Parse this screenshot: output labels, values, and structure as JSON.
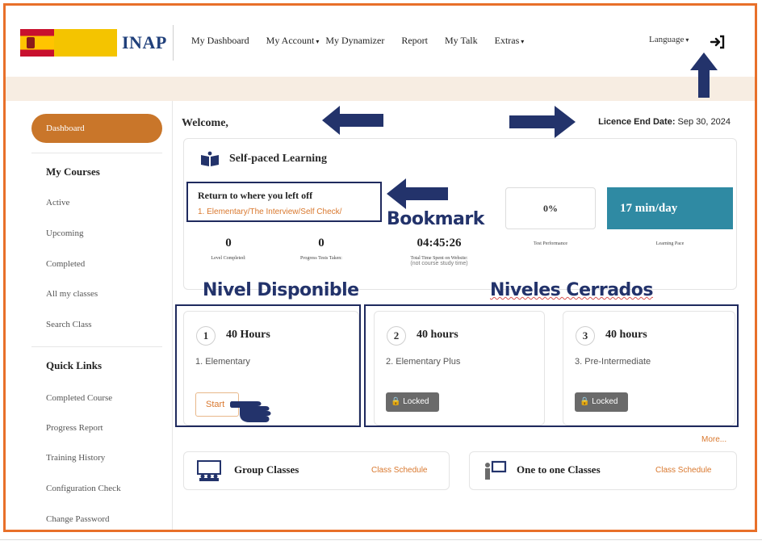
{
  "header": {
    "logo_text": "INAP",
    "nav": [
      {
        "label": "My Dashboard",
        "dropdown": false
      },
      {
        "label": "My Account",
        "dropdown": true
      },
      {
        "label": "My Dynamizer",
        "dropdown": false
      },
      {
        "label": "Report",
        "dropdown": false
      },
      {
        "label": "My Talk",
        "dropdown": false
      },
      {
        "label": "Extras",
        "dropdown": true
      }
    ],
    "language": "Language"
  },
  "sidebar": {
    "dashboard": "Dashboard",
    "courses_heading": "My Courses",
    "courses": [
      "Active",
      "Upcoming",
      "Completed",
      "All my classes",
      "Search Class"
    ],
    "links_heading": "Quick Links",
    "links": [
      "Completed Course",
      "Progress Report",
      "Training History",
      "Configuration Check",
      "Change Password"
    ]
  },
  "main": {
    "welcome": "Welcome,",
    "licence_label": "Licence End Date:",
    "licence_date": "Sep 30, 2024",
    "spl": {
      "title": "Self-paced Learning",
      "return_title": "Return to where you left off",
      "return_link": "1. Elementary/The Interview/Self Check/",
      "test_performance": "0%",
      "test_performance_label": "Test Performance",
      "learning_pace": "17 min/day",
      "learning_pace_label": "Learning Pace",
      "stats": [
        {
          "value": "0",
          "label": "Level Completed:"
        },
        {
          "value": "0",
          "label": "Progress Tests Taken:"
        },
        {
          "value": "04:45:26",
          "label": "Total Time Spent on Website:",
          "sub": "(not course study time)"
        }
      ]
    },
    "levels": [
      {
        "num": "1",
        "hours": "40 Hours",
        "name": "1. Elementary",
        "action": "Start"
      },
      {
        "num": "2",
        "hours": "40 hours",
        "name": "2. Elementary Plus",
        "action": "Locked"
      },
      {
        "num": "3",
        "hours": "40 hours",
        "name": "3. Pre-Intermediate",
        "action": "Locked"
      }
    ],
    "more": "More...",
    "classes": [
      {
        "title": "Group Classes",
        "link": "Class Schedule"
      },
      {
        "title": "One to one Classes",
        "link": "Class Schedule"
      }
    ]
  },
  "annotations": {
    "bookmark": "Bookmark",
    "available_level": "Nivel Disponible",
    "closed_levels": "Niveles Cerrados"
  },
  "colors": {
    "frame": "#e8702a",
    "accent": "#c9762a",
    "pace": "#2f8aa3",
    "annotation": "#23336b"
  }
}
